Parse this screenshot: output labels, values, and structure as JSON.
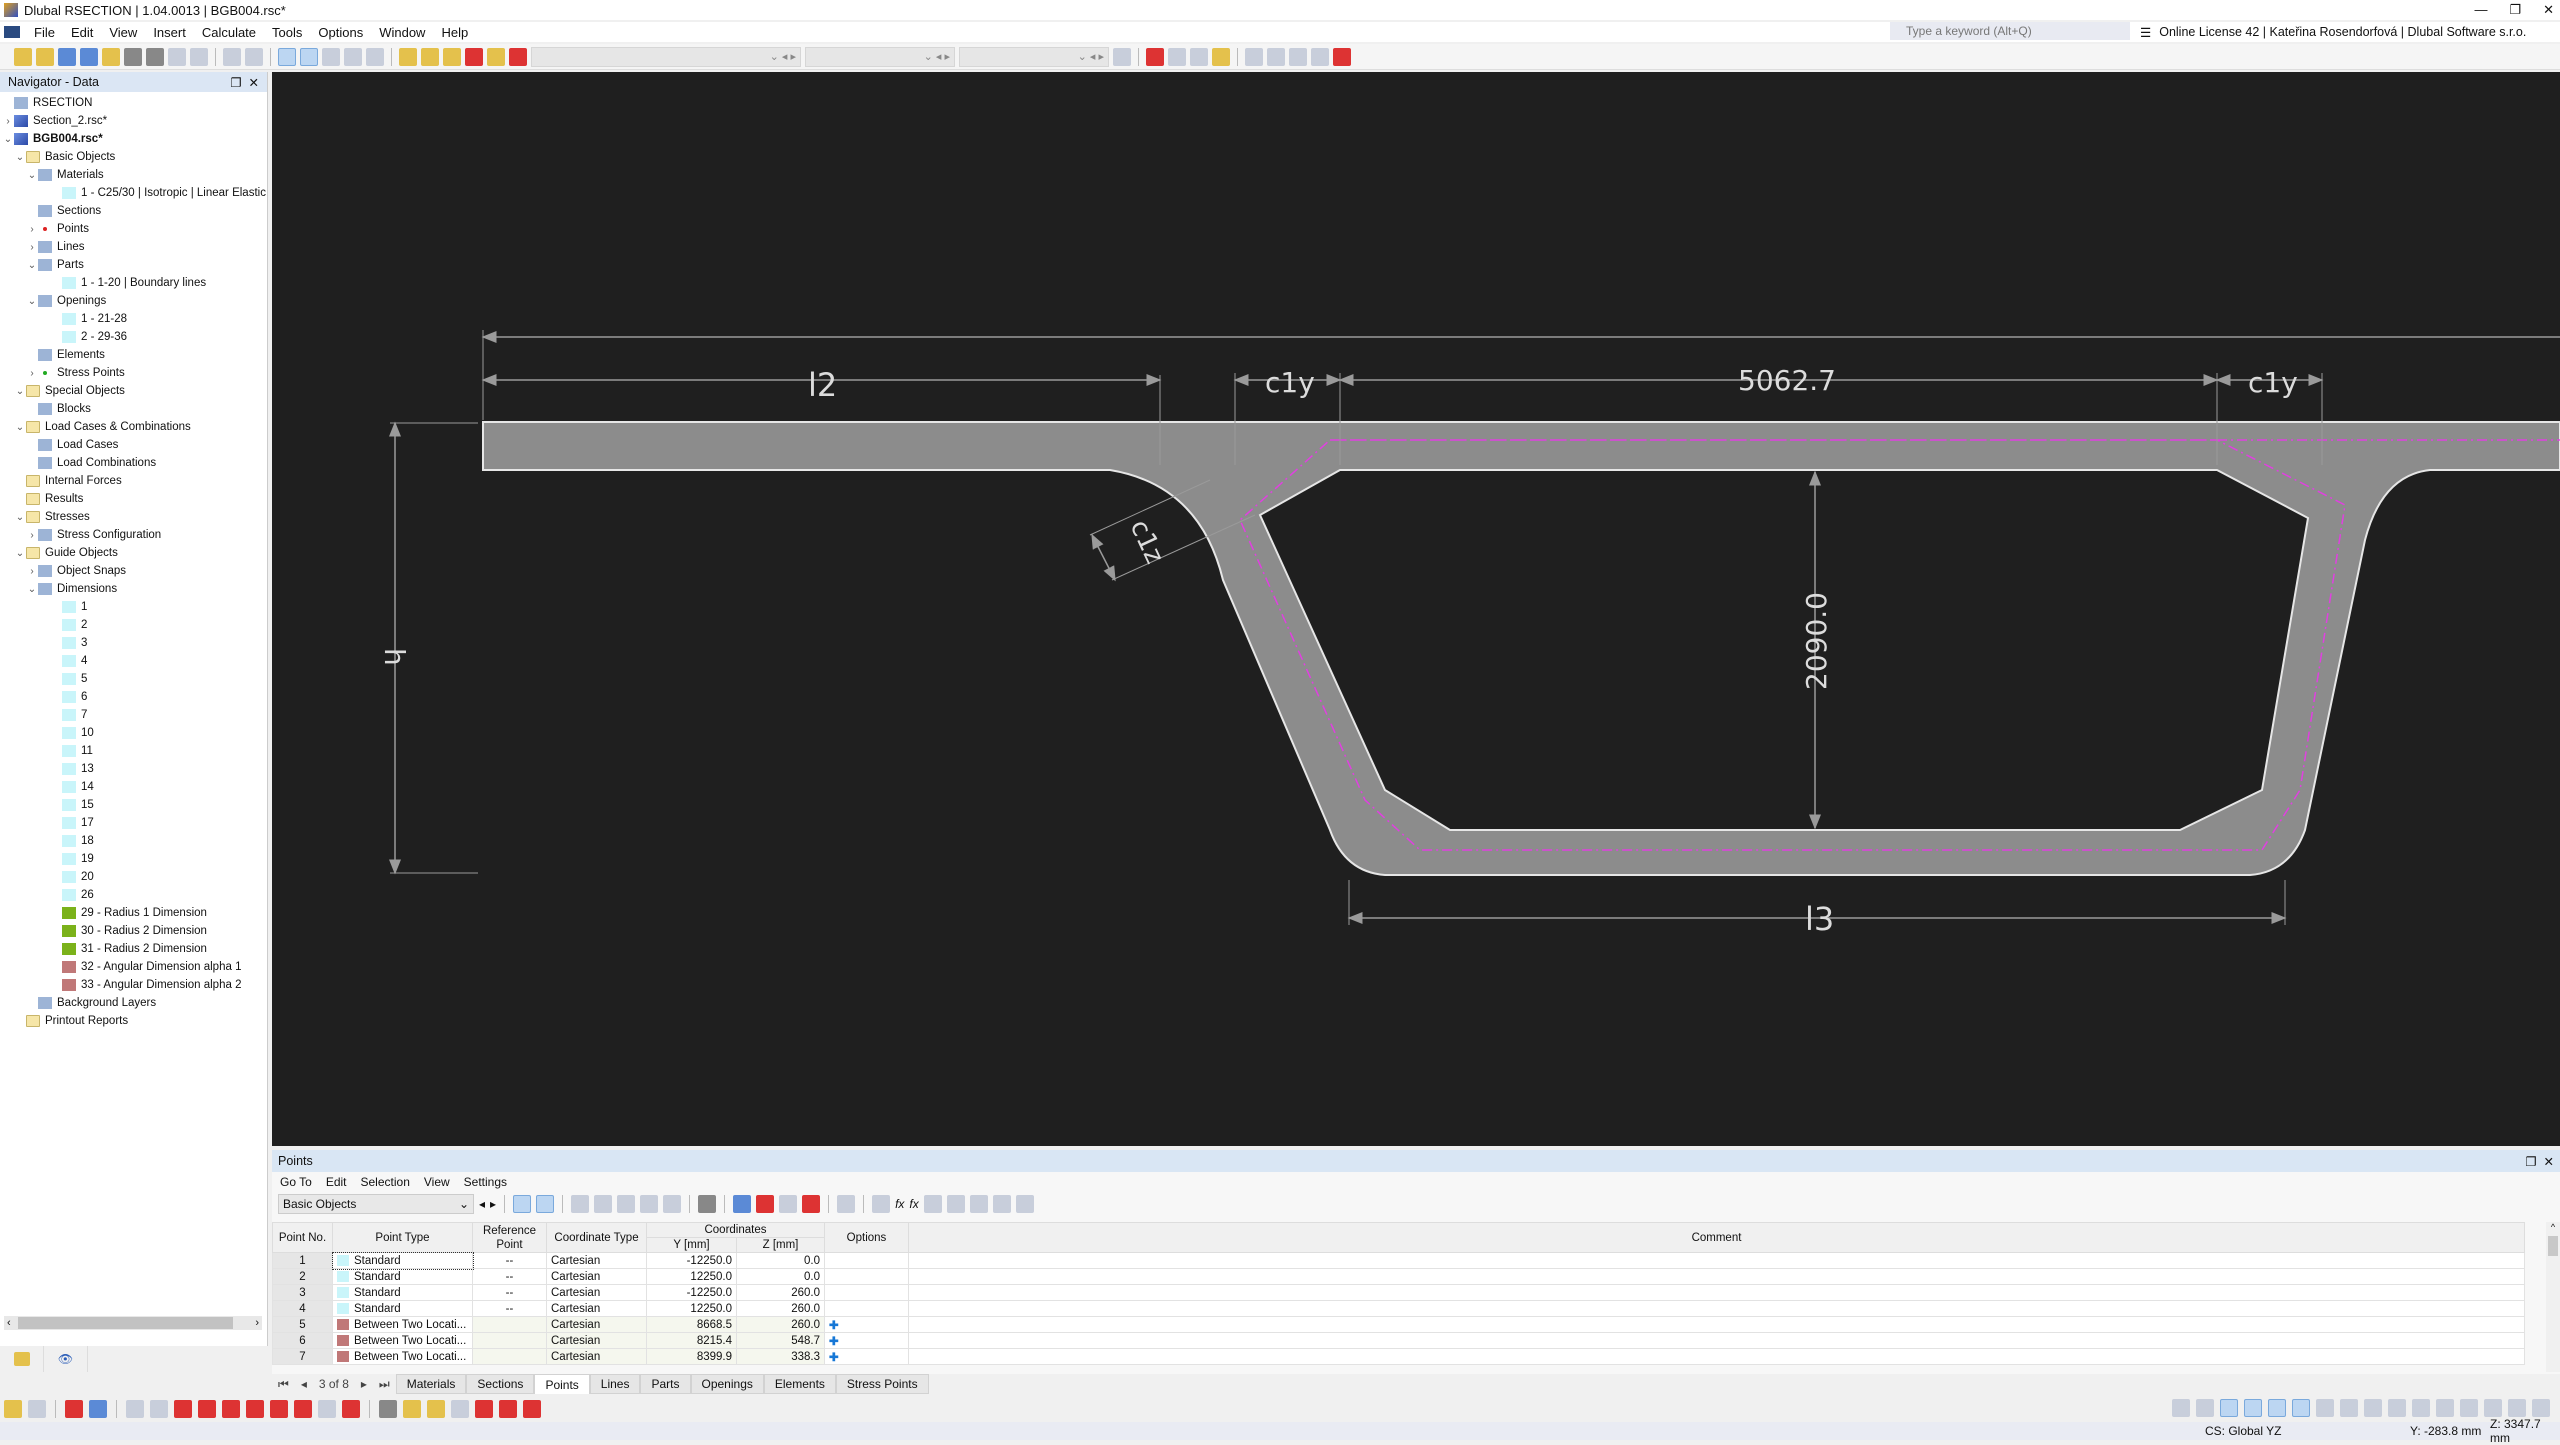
{
  "window": {
    "title": "Dlubal RSECTION | 1.04.0013 | BGB004.rsc*",
    "controls": [
      "minimize",
      "restore",
      "close"
    ]
  },
  "menu": [
    "File",
    "Edit",
    "View",
    "Insert",
    "Calculate",
    "Tools",
    "Options",
    "Window",
    "Help"
  ],
  "search": {
    "placeholder": "Type a keyword (Alt+Q)"
  },
  "license": "Online License 42 | Kateřina Rosendorfová | Dlubal Software s.r.o.",
  "navigator": {
    "title": "Navigator - Data",
    "tree": [
      {
        "label": "RSECTION",
        "level": 0,
        "icon": "app",
        "arrow": ""
      },
      {
        "label": "Section_2.rsc*",
        "level": 0,
        "icon": "file",
        "arrow": ">"
      },
      {
        "label": "BGB004.rsc*",
        "level": 0,
        "icon": "file",
        "arrow": "v",
        "bold": true
      },
      {
        "label": "Basic Objects",
        "level": 1,
        "icon": "folder",
        "arrow": "v"
      },
      {
        "label": "Materials",
        "level": 2,
        "icon": "materials",
        "arrow": "v"
      },
      {
        "label": "1 - C25/30 | Isotropic | Linear Elastic",
        "level": 3,
        "icon": "sw",
        "arrow": ""
      },
      {
        "label": "Sections",
        "level": 2,
        "icon": "sections",
        "arrow": ""
      },
      {
        "label": "Points",
        "level": 2,
        "icon": "dot",
        "arrow": ">"
      },
      {
        "label": "Lines",
        "level": 2,
        "icon": "line",
        "arrow": ">"
      },
      {
        "label": "Parts",
        "level": 2,
        "icon": "parts",
        "arrow": "v"
      },
      {
        "label": "1 - 1-20 | Boundary lines",
        "level": 3,
        "icon": "sw",
        "arrow": ""
      },
      {
        "label": "Openings",
        "level": 2,
        "icon": "openings",
        "arrow": "v"
      },
      {
        "label": "1 - 21-28",
        "level": 3,
        "icon": "sw",
        "arrow": ""
      },
      {
        "label": "2 - 29-36",
        "level": 3,
        "icon": "sw",
        "arrow": ""
      },
      {
        "label": "Elements",
        "level": 2,
        "icon": "elements",
        "arrow": ""
      },
      {
        "label": "Stress Points",
        "level": 2,
        "icon": "dotg",
        "arrow": ">"
      },
      {
        "label": "Special Objects",
        "level": 1,
        "icon": "folder",
        "arrow": "v"
      },
      {
        "label": "Blocks",
        "level": 2,
        "icon": "blocks",
        "arrow": ""
      },
      {
        "label": "Load Cases & Combinations",
        "level": 1,
        "icon": "folder",
        "arrow": "v"
      },
      {
        "label": "Load Cases",
        "level": 2,
        "icon": "loadcases",
        "arrow": ""
      },
      {
        "label": "Load Combinations",
        "level": 2,
        "icon": "loadcombos",
        "arrow": ""
      },
      {
        "label": "Internal Forces",
        "level": 1,
        "icon": "folder",
        "arrow": ""
      },
      {
        "label": "Results",
        "level": 1,
        "icon": "folder",
        "arrow": ""
      },
      {
        "label": "Stresses",
        "level": 1,
        "icon": "folder",
        "arrow": "v"
      },
      {
        "label": "Stress Configuration",
        "level": 2,
        "icon": "stressconfig",
        "arrow": ">"
      },
      {
        "label": "Guide Objects",
        "level": 1,
        "icon": "folder",
        "arrow": "v"
      },
      {
        "label": "Object Snaps",
        "level": 2,
        "icon": "magnet",
        "arrow": ">"
      },
      {
        "label": "Dimensions",
        "level": 2,
        "icon": "dimension",
        "arrow": "v"
      },
      {
        "label": "1",
        "level": 3,
        "icon": "sw",
        "arrow": ""
      },
      {
        "label": "2",
        "level": 3,
        "icon": "sw",
        "arrow": ""
      },
      {
        "label": "3",
        "level": 3,
        "icon": "sw",
        "arrow": ""
      },
      {
        "label": "4",
        "level": 3,
        "icon": "sw",
        "arrow": ""
      },
      {
        "label": "5",
        "level": 3,
        "icon": "sw",
        "arrow": ""
      },
      {
        "label": "6",
        "level": 3,
        "icon": "sw",
        "arrow": ""
      },
      {
        "label": "7",
        "level": 3,
        "icon": "sw",
        "arrow": ""
      },
      {
        "label": "10",
        "level": 3,
        "icon": "sw",
        "arrow": ""
      },
      {
        "label": "11",
        "level": 3,
        "icon": "sw",
        "arrow": ""
      },
      {
        "label": "13",
        "level": 3,
        "icon": "sw",
        "arrow": ""
      },
      {
        "label": "14",
        "level": 3,
        "icon": "sw",
        "arrow": ""
      },
      {
        "label": "15",
        "level": 3,
        "icon": "sw",
        "arrow": ""
      },
      {
        "label": "17",
        "level": 3,
        "icon": "sw",
        "arrow": ""
      },
      {
        "label": "18",
        "level": 3,
        "icon": "sw",
        "arrow": ""
      },
      {
        "label": "19",
        "level": 3,
        "icon": "sw",
        "arrow": ""
      },
      {
        "label": "20",
        "level": 3,
        "icon": "sw",
        "arrow": ""
      },
      {
        "label": "26",
        "level": 3,
        "icon": "sw",
        "arrow": ""
      },
      {
        "label": "29 - Radius 1 Dimension",
        "level": 3,
        "icon": "sw-g",
        "arrow": ""
      },
      {
        "label": "30 - Radius 2 Dimension",
        "level": 3,
        "icon": "sw-g",
        "arrow": ""
      },
      {
        "label": "31 - Radius 2 Dimension",
        "level": 3,
        "icon": "sw-g",
        "arrow": ""
      },
      {
        "label": "32 - Angular Dimension alpha 1",
        "level": 3,
        "icon": "sw-r",
        "arrow": ""
      },
      {
        "label": "33 - Angular Dimension alpha 2",
        "level": 3,
        "icon": "sw-r",
        "arrow": ""
      },
      {
        "label": "Background Layers",
        "level": 2,
        "icon": "layers",
        "arrow": ""
      },
      {
        "label": "Printout Reports",
        "level": 1,
        "icon": "folder",
        "arrow": ""
      }
    ]
  },
  "drawing": {
    "dimensions": {
      "l2": "l2",
      "c1y_left": "c1y",
      "top_width": "5062.7",
      "c1y_right": "c1y",
      "c1z": "c1z",
      "h": "h",
      "inner_height": "2090.0",
      "l3": "l3"
    },
    "colors": {
      "background": "#1f1f1f",
      "section_fill": "#8c8c8c",
      "outline": "#e6e6e6",
      "centerline": "#e040e0",
      "dimension": "#9a9a9a"
    }
  },
  "points_panel": {
    "title": "Points",
    "menu": [
      "Go To",
      "Edit",
      "Selection",
      "View",
      "Settings"
    ],
    "object_filter": "Basic Objects",
    "columns": {
      "point_no": "Point No.",
      "point_type": "Point Type",
      "reference_point": "Reference Point",
      "coordinate_type": "Coordinate Type",
      "coordinates": "Coordinates",
      "y": "Y [mm]",
      "z": "Z [mm]",
      "options": "Options",
      "comment": "Comment"
    },
    "rows": [
      {
        "no": "1",
        "type": "Standard",
        "type_color": "#c9f5fa",
        "ref": "--",
        "ctype": "Cartesian",
        "y": "-12250.0",
        "z": "0.0",
        "option": ""
      },
      {
        "no": "2",
        "type": "Standard",
        "type_color": "#c9f5fa",
        "ref": "--",
        "ctype": "Cartesian",
        "y": "12250.0",
        "z": "0.0",
        "option": ""
      },
      {
        "no": "3",
        "type": "Standard",
        "type_color": "#c9f5fa",
        "ref": "--",
        "ctype": "Cartesian",
        "y": "-12250.0",
        "z": "260.0",
        "option": ""
      },
      {
        "no": "4",
        "type": "Standard",
        "type_color": "#c9f5fa",
        "ref": "--",
        "ctype": "Cartesian",
        "y": "12250.0",
        "z": "260.0",
        "option": ""
      },
      {
        "no": "5",
        "type": "Between Two Locati...",
        "type_color": "#c07878",
        "ref": "",
        "ctype": "Cartesian",
        "y": "8668.5",
        "z": "260.0",
        "option": "✚"
      },
      {
        "no": "6",
        "type": "Between Two Locati...",
        "type_color": "#c07878",
        "ref": "",
        "ctype": "Cartesian",
        "y": "8215.4",
        "z": "548.7",
        "option": "✚"
      },
      {
        "no": "7",
        "type": "Between Two Locati...",
        "type_color": "#c07878",
        "ref": "",
        "ctype": "Cartesian",
        "y": "8399.9",
        "z": "338.3",
        "option": "✚"
      }
    ],
    "pager": "3 of 8",
    "tabs": [
      "Materials",
      "Sections",
      "Points",
      "Lines",
      "Parts",
      "Openings",
      "Elements",
      "Stress Points"
    ],
    "active_tab": "Points"
  },
  "status": {
    "cs": "CS: Global YZ",
    "y": "Y: -283.8 mm",
    "z": "Z: 3347.7 mm"
  }
}
